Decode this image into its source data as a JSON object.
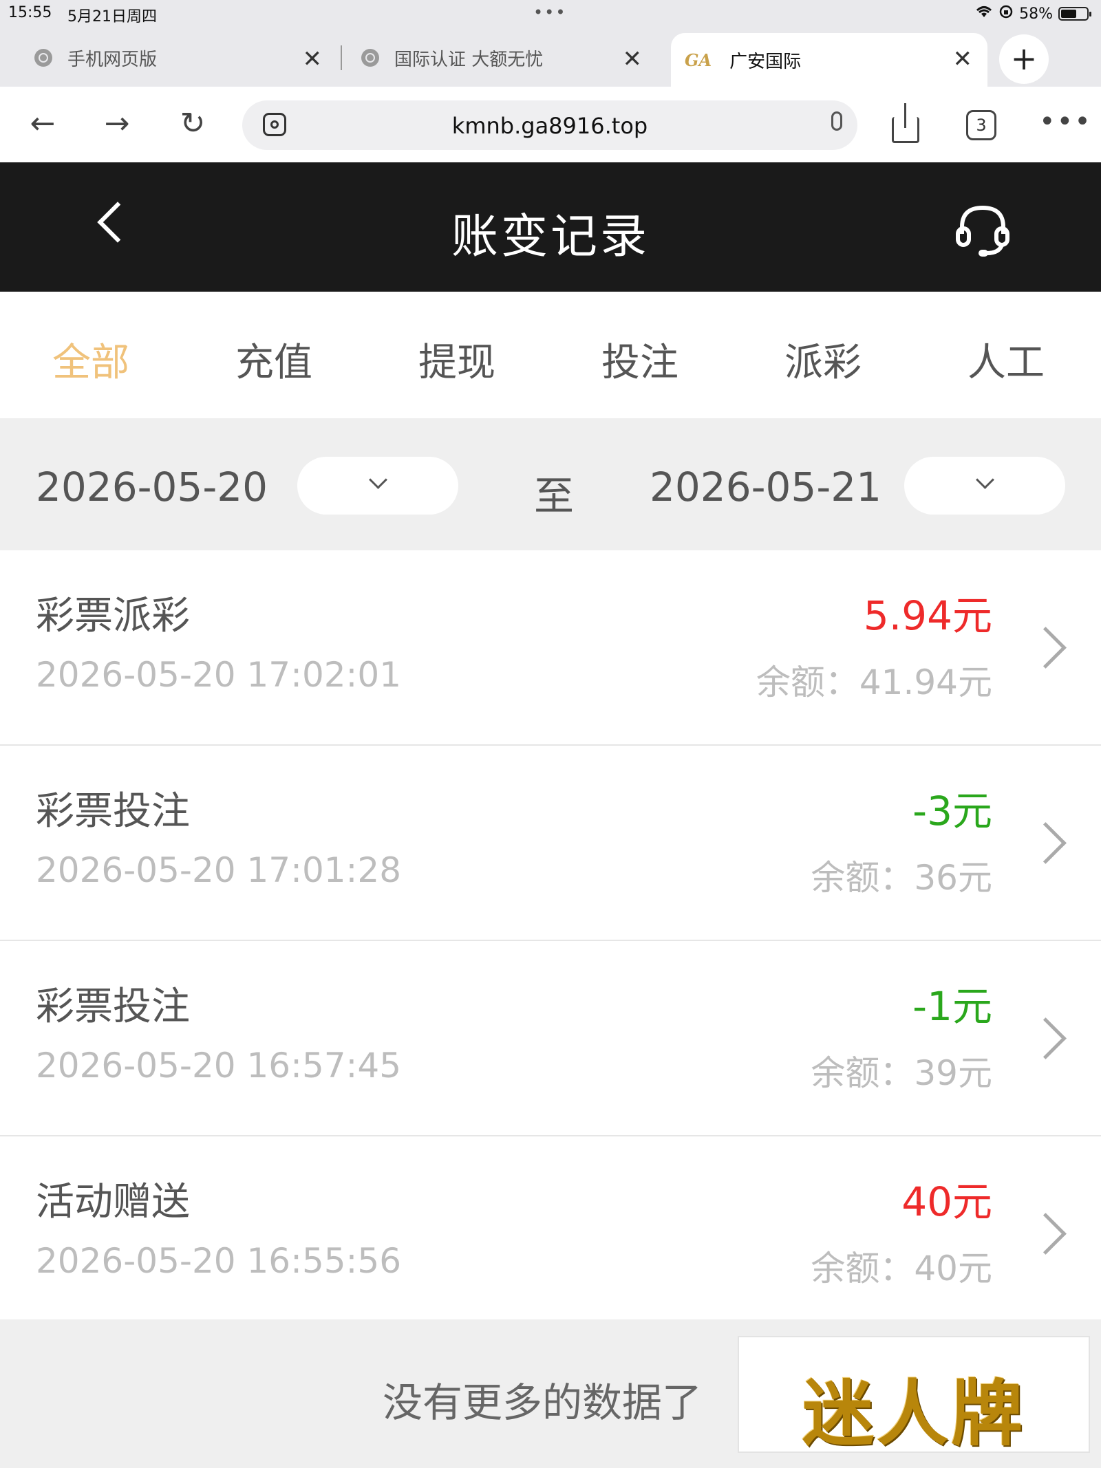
{
  "statusbar": {
    "time": "15:55",
    "date": "5月21日周四",
    "dots": "•••",
    "battery": "58%"
  },
  "browser": {
    "tabs": [
      {
        "title": "手机网页版"
      },
      {
        "title": "国际认证 大额无忧"
      },
      {
        "title": "广安国际",
        "favicon_text": "GA"
      }
    ],
    "new_tab": "+",
    "url": "kmnb.ga8916.top",
    "tab_count": "3",
    "close_glyph": "✕",
    "more_glyph": "•••",
    "back_glyph": "←",
    "forward_glyph": "→",
    "reload_glyph": "↻"
  },
  "header": {
    "title": "账变记录"
  },
  "filters": [
    "全部",
    "充值",
    "提现",
    "投注",
    "派彩",
    "人工"
  ],
  "active_filter": "全部",
  "date_range": {
    "start": "2026-05-20",
    "separator": "至",
    "end": "2026-05-21"
  },
  "records": [
    {
      "title": "彩票派彩",
      "time": "2026-05-20 17:02:01",
      "amount": "5.94元",
      "balance": "余额：41.94元",
      "type": "pos"
    },
    {
      "title": "彩票投注",
      "time": "2026-05-20 17:01:28",
      "amount": "-3元",
      "balance": "余额：36元",
      "type": "neg"
    },
    {
      "title": "彩票投注",
      "time": "2026-05-20 16:57:45",
      "amount": "-1元",
      "balance": "余额：39元",
      "type": "neg"
    },
    {
      "title": "活动赠送",
      "time": "2026-05-20 16:55:56",
      "amount": "40元",
      "balance": "余额：40元",
      "type": "pos"
    }
  ],
  "footer": {
    "no_more": "没有更多的数据了",
    "logo": "迷人牌"
  },
  "colors": {
    "accent": "#f0c27b",
    "positive": "#ee2a2a",
    "negative": "#2aa71c",
    "header_bg": "#1a1a1a"
  }
}
